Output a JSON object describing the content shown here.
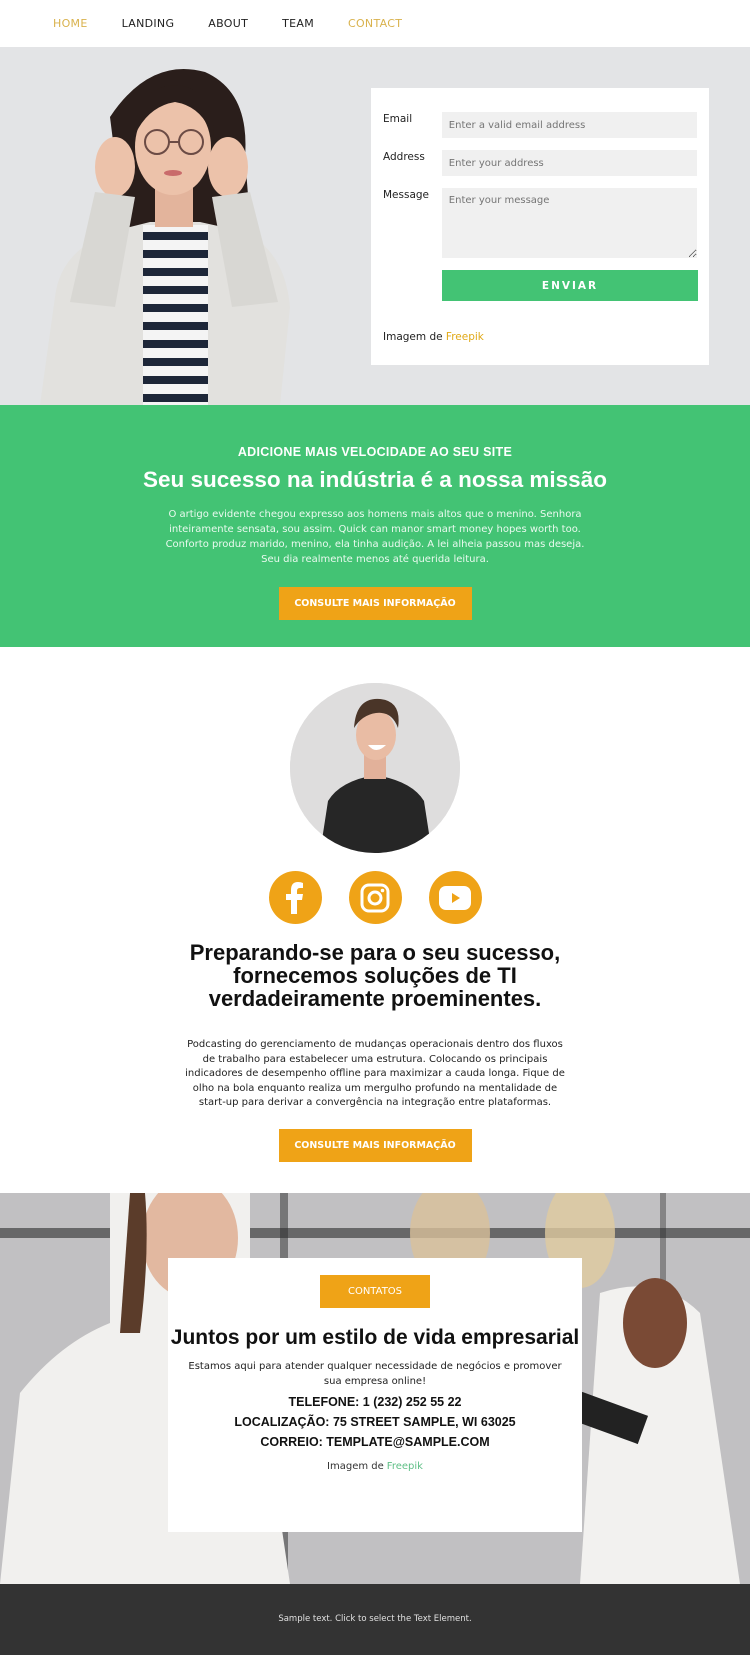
{
  "nav": {
    "items": [
      {
        "label": "HOME",
        "active": true
      },
      {
        "label": "LANDING",
        "active": false
      },
      {
        "label": "ABOUT",
        "active": false
      },
      {
        "label": "TEAM",
        "active": false
      },
      {
        "label": "CONTACT",
        "active": true
      }
    ]
  },
  "hero": {
    "image_alt": "Woman adjusting glasses",
    "form": {
      "email_label": "Email",
      "email_placeholder": "Enter a valid email address",
      "address_label": "Address",
      "address_placeholder": "Enter your address",
      "message_label": "Message",
      "message_placeholder": "Enter your message",
      "submit_label": "ENVIAR"
    },
    "credit_prefix": "Imagem de ",
    "credit_link": "Freepik"
  },
  "green": {
    "kicker": "ADICIONE MAIS VELOCIDADE AO SEU SITE",
    "title": "Seu sucesso na indústria é a nossa missão",
    "body": "O artigo evidente chegou expresso aos homens mais altos que o menino. Senhora inteiramente sensata, sou assim. Quick can manor smart money hopes worth too. Conforto produz marido, menino, ela tinha audição. A lei alheia passou mas deseja. Seu dia realmente menos até querida leitura.",
    "button": "CONSULTE MAIS INFORMAÇÃO"
  },
  "mid": {
    "avatar_alt": "Smiling man in black t-shirt",
    "social": [
      "facebook",
      "instagram",
      "youtube"
    ],
    "title": "Preparando-se para o seu sucesso, fornecemos soluções de TI verdadeiramente proeminentes.",
    "body": "Podcasting do gerenciamento de mudanças operacionais dentro dos fluxos de trabalho para estabelecer uma estrutura. Colocando os principais indicadores de desempenho offline para maximizar a cauda longa. Fique de olho na bola enquanto realiza um mergulho profundo na mentalidade de start-up para derivar a convergência na integração entre plataformas.",
    "button": "CONSULTE MAIS INFORMAÇÃO"
  },
  "contact": {
    "button": "CONTATOS",
    "title": "Juntos por um estilo de vida empresarial",
    "desc": "Estamos aqui para atender qualquer necessidade de negócios e promover sua empresa online!",
    "phone": "TELEFONE: 1 (232) 252 55 22",
    "location": "LOCALIZAÇÃO: 75 STREET SAMPLE, WI 63025",
    "email": "CORREIO: TEMPLATE@SAMPLE.COM",
    "credit_prefix": "Imagem de",
    "credit_link": "Freepik"
  },
  "footer": {
    "text": "Sample text. Click to select the Text Element."
  },
  "colors": {
    "green": "#43c374",
    "orange": "#efa317",
    "nav_accent": "#d9b24d",
    "footer_bg": "#333333"
  }
}
